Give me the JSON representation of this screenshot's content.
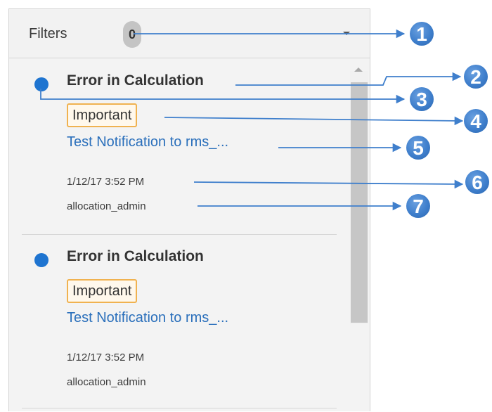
{
  "filters": {
    "label": "Filters",
    "count": "0"
  },
  "notifications": [
    {
      "title": "Error in Calculation",
      "priority": "Important",
      "link_text": "Test Notification to rms_...",
      "timestamp": "1/12/17 3:52 PM",
      "user": "allocation_admin",
      "unread": true
    },
    {
      "title": "Error in Calculation",
      "priority": "Important",
      "link_text": "Test Notification to rms_...",
      "timestamp": "1/12/17 3:52 PM",
      "user": "allocation_admin",
      "unread": true
    }
  ],
  "callouts": [
    "1",
    "2",
    "3",
    "4",
    "5",
    "6",
    "7"
  ],
  "colors": {
    "unread_dot": "#1e74d0",
    "priority_border": "#f0b250",
    "link": "#2a6fbb",
    "callout": "#3f7fcc"
  }
}
